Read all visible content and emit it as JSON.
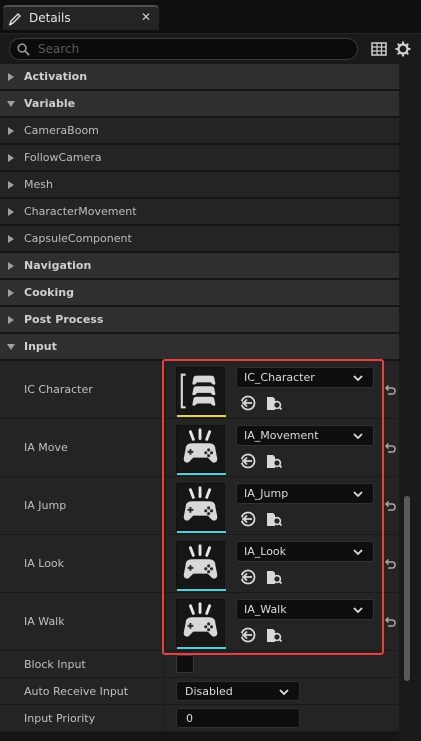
{
  "tab": {
    "title": "Details",
    "icon": "pencil-icon",
    "close": "✕"
  },
  "search": {
    "placeholder": "Search",
    "value": ""
  },
  "toolbar": {
    "table_icon": "table-view-icon",
    "settings_icon": "gear-icon"
  },
  "categories": {
    "activation": "Activation",
    "variable": "Variable",
    "navigation": "Navigation",
    "cooking": "Cooking",
    "post_process": "Post Process",
    "input": "Input"
  },
  "variable_items": [
    "CameraBoom",
    "FollowCamera",
    "Mesh",
    "CharacterMovement",
    "CapsuleComponent"
  ],
  "input_assets": [
    {
      "label": "IC Character",
      "value": "IC_Character",
      "thumb_type": "input-mapping-context",
      "accent": "#e8d44d"
    },
    {
      "label": "IA Move",
      "value": "IA_Movement",
      "thumb_type": "input-action",
      "accent": "#4fd0e0"
    },
    {
      "label": "IA Jump",
      "value": "IA_Jump",
      "thumb_type": "input-action",
      "accent": "#4fd0e0"
    },
    {
      "label": "IA Look",
      "value": "IA_Look",
      "thumb_type": "input-action",
      "accent": "#4fd0e0"
    },
    {
      "label": "IA Walk",
      "value": "IA_Walk",
      "thumb_type": "input-action",
      "accent": "#4fd0e0"
    }
  ],
  "block_input": {
    "label": "Block Input",
    "checked": false
  },
  "auto_receive_input": {
    "label": "Auto Receive Input",
    "value": "Disabled"
  },
  "input_priority": {
    "label": "Input Priority",
    "value": "0"
  },
  "colors": {
    "highlight": "#e6413f",
    "panel_bg": "#242424",
    "category_bg": "#2f2f2f"
  }
}
